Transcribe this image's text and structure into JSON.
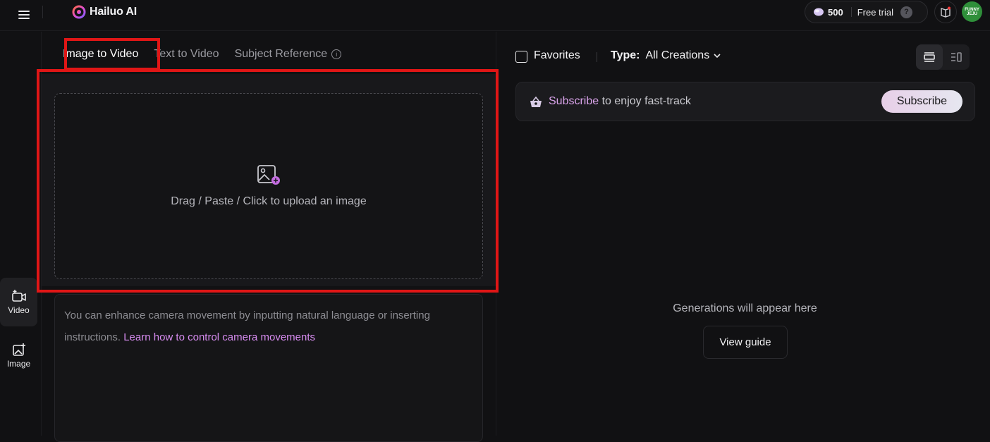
{
  "header": {
    "logo_text": "Hailuo AI",
    "credits": "500",
    "free_trial": "Free trial",
    "help_glyph": "?",
    "avatar_text": "FUNNY JEJU"
  },
  "sidebar": {
    "items": [
      {
        "label": "Video",
        "icon": "video-plus-icon",
        "active": true
      },
      {
        "label": "Image",
        "icon": "image-plus-icon",
        "active": false
      }
    ]
  },
  "create": {
    "tabs": [
      {
        "label": "Image to Video",
        "active": true
      },
      {
        "label": "Text to Video",
        "active": false
      },
      {
        "label": "Subject Reference",
        "active": false
      }
    ],
    "info_glyph": "i",
    "upload_text": "Drag / Paste / Click to upload an image",
    "prompt_placeholder": "You can enhance camera movement by inputting natural language or inserting instructions.",
    "prompt_link": "Learn how to control camera movements"
  },
  "results": {
    "favorites_label": "Favorites",
    "type_label": "Type:",
    "type_value": "All Creations",
    "subscribe_highlight": "Subscribe",
    "subscribe_rest": " to enjoy fast-track",
    "subscribe_button": "Subscribe",
    "empty_text": "Generations will appear here",
    "view_guide": "View guide"
  },
  "colors": {
    "background": "#111113",
    "accent_pink": "#d78cf0",
    "highlight_red": "#e01616"
  }
}
